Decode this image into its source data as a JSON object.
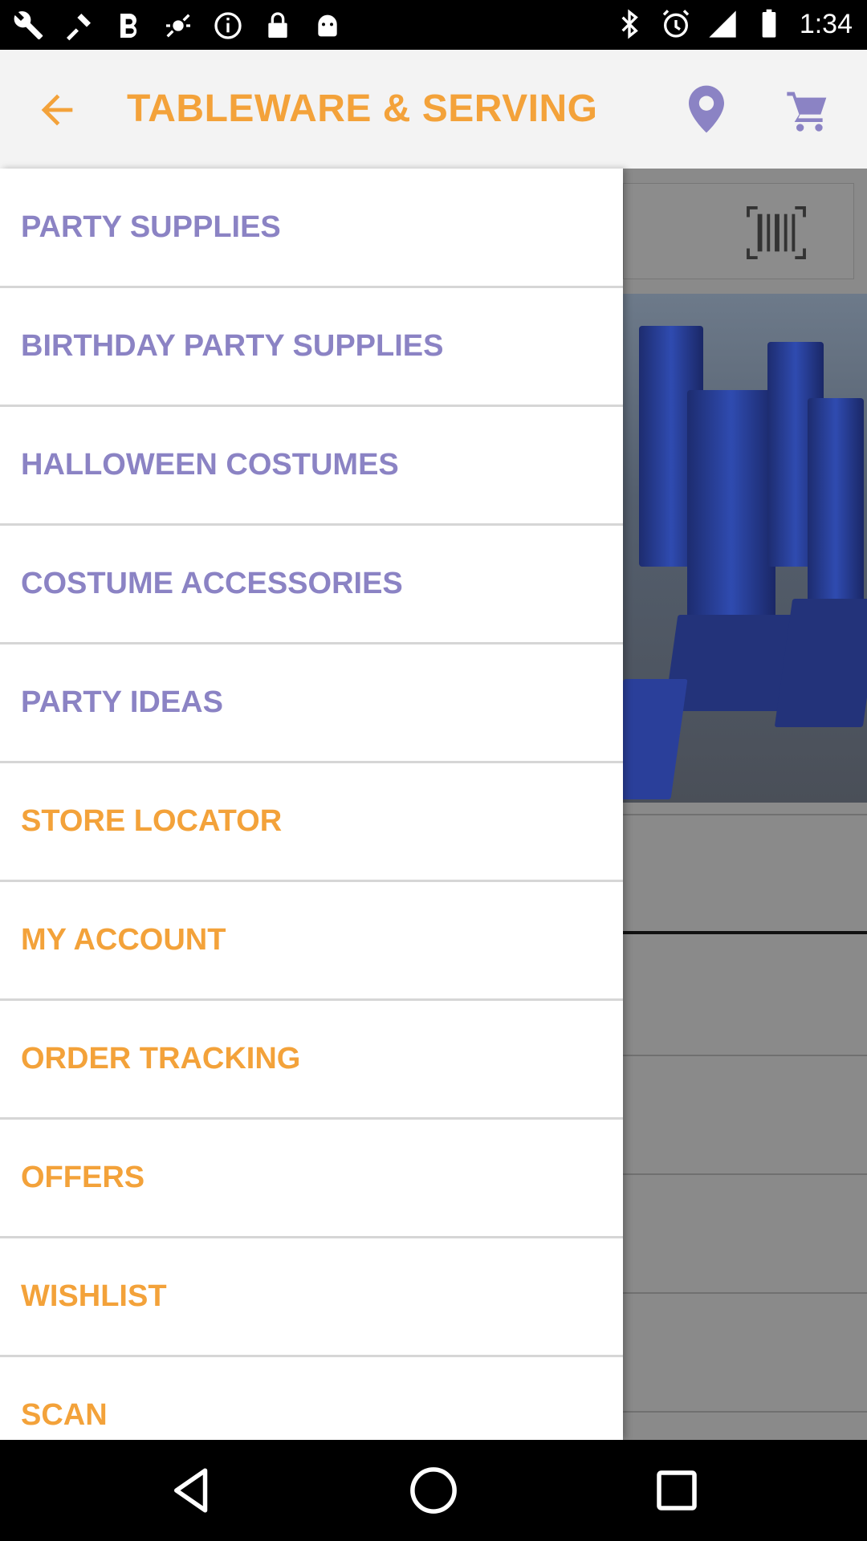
{
  "status_bar": {
    "time": "1:34",
    "left_icons": [
      "wrench-icon",
      "tool-icon",
      "bold-b-icon",
      "fake-gps-icon",
      "info-icon",
      "lock-icon",
      "android-icon"
    ],
    "right_icons": [
      "bluetooth-icon",
      "alarm-icon",
      "signal-icon",
      "battery-icon"
    ]
  },
  "app_bar": {
    "title": "TABLEWARE & SERVING",
    "accent_color": "#f3a23a"
  },
  "drawer": {
    "items": [
      {
        "label": "PARTY SUPPLIES",
        "style": "purple"
      },
      {
        "label": "BIRTHDAY PARTY SUPPLIES",
        "style": "purple"
      },
      {
        "label": "HALLOWEEN COSTUMES",
        "style": "purple"
      },
      {
        "label": "COSTUME ACCESSORIES",
        "style": "purple"
      },
      {
        "label": "PARTY IDEAS",
        "style": "purple"
      },
      {
        "label": "STORE LOCATOR",
        "style": "orange"
      },
      {
        "label": "MY ACCOUNT",
        "style": "orange"
      },
      {
        "label": "ORDER TRACKING",
        "style": "orange"
      },
      {
        "label": "OFFERS",
        "style": "orange"
      },
      {
        "label": "WISHLIST",
        "style": "orange"
      },
      {
        "label": "SCAN",
        "style": "orange"
      }
    ],
    "colors": {
      "purple": "#8b83c4",
      "orange": "#f3a23a"
    }
  },
  "nav_bar": {
    "buttons": [
      "back-triangle-icon",
      "home-circle-icon",
      "recents-square-icon"
    ]
  }
}
